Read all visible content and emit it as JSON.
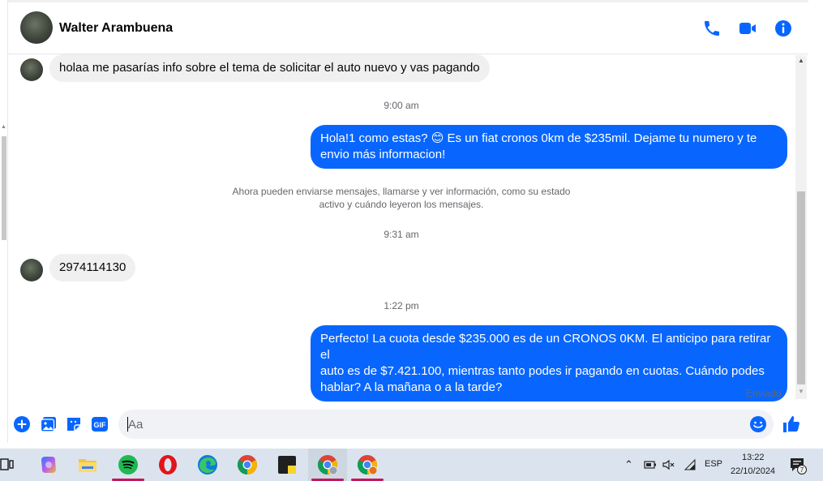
{
  "header": {
    "contact_name": "Walter Arambuena",
    "icons": [
      "phone-icon",
      "video-call-icon",
      "info-icon"
    ]
  },
  "messages": [
    {
      "type": "incoming",
      "text": "holaa me pasarías info sobre el tema de solicitar el auto nuevo y vas pagando"
    },
    {
      "type": "timestamp",
      "text": "9:00 am"
    },
    {
      "type": "outgoing",
      "lines": [
        "Hola!1 como estas? 😊 Es un fiat cronos 0km de $235mil. Dejame tu numero y te",
        "envio más informacion!"
      ]
    },
    {
      "type": "system",
      "lines": [
        "Ahora pueden enviarse mensajes, llamarse y ver información, como su estado",
        "activo y cuándo leyeron los mensajes."
      ]
    },
    {
      "type": "timestamp",
      "text": "9:31 am"
    },
    {
      "type": "incoming",
      "text": "2974114130"
    },
    {
      "type": "timestamp",
      "text": "1:22 pm"
    },
    {
      "type": "outgoing",
      "lines": [
        "Perfecto! La cuota desde $235.000 es de un CRONOS 0KM. El anticipo para retirar el",
        "auto es de $7.421.100, mientras tanto podes ir pagando en cuotas. Cuándo podes",
        "hablar? A la mañana o a la tarde?"
      ]
    }
  ],
  "status": {
    "delivered": "Enviado"
  },
  "composer": {
    "placeholder": "Aa",
    "left_icons": [
      "add-icon",
      "photo-icon",
      "sticker-icon",
      "gif-icon"
    ],
    "gif_label": "GIF"
  },
  "taskbar": {
    "apps": [
      "task-view",
      "copilot",
      "file-explorer",
      "spotify",
      "opera",
      "edge",
      "chrome",
      "sticky-notes",
      "chrome-profile-1",
      "chrome-profile-2"
    ],
    "language": "ESP",
    "time": "13:22",
    "date": "22/10/2024",
    "notification_count": "7"
  },
  "colors": {
    "accent": "#0866ff",
    "incoming_bubble": "#f0f0f0",
    "taskbar": "#dbe4ee"
  }
}
